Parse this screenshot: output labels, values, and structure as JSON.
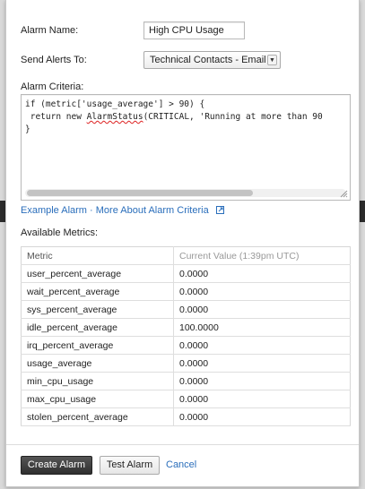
{
  "form": {
    "alarm_name_label": "Alarm Name:",
    "alarm_name_value": "High CPU Usage",
    "send_alerts_label": "Send Alerts To:",
    "send_alerts_value": "Technical Contacts - Email",
    "criteria_label": "Alarm Criteria:",
    "criteria_lines": [
      "if (metric['usage_average'] > 90) {",
      " return new ",
      "AlarmStatus",
      "(CRITICAL, 'Running at more than 90",
      "}"
    ]
  },
  "links": {
    "example_alarm": "Example Alarm",
    "separator": " · ",
    "more_about": "More About Alarm Criteria"
  },
  "metrics": {
    "section_label": "Available Metrics:",
    "col_metric": "Metric",
    "col_value": "Current Value (1:39pm UTC)",
    "rows": [
      {
        "name": "user_percent_average",
        "value": "0.0000"
      },
      {
        "name": "wait_percent_average",
        "value": "0.0000"
      },
      {
        "name": "sys_percent_average",
        "value": "0.0000"
      },
      {
        "name": "idle_percent_average",
        "value": "100.0000"
      },
      {
        "name": "irq_percent_average",
        "value": "0.0000"
      },
      {
        "name": "usage_average",
        "value": "0.0000"
      },
      {
        "name": "min_cpu_usage",
        "value": "0.0000"
      },
      {
        "name": "max_cpu_usage",
        "value": "0.0000"
      },
      {
        "name": "stolen_percent_average",
        "value": "0.0000"
      }
    ]
  },
  "actions": {
    "create_label": "Create Alarm",
    "test_label": "Test Alarm",
    "cancel_label": "Cancel"
  },
  "colors": {
    "link": "#2a6ebb",
    "primary_button": "#333333",
    "spellcheck_underline": "#dd2222"
  },
  "icons": {
    "external_link": "external-link-icon",
    "dropdown_caret": "chevron-down-icon",
    "resize_grip": "resize-grip-icon"
  }
}
